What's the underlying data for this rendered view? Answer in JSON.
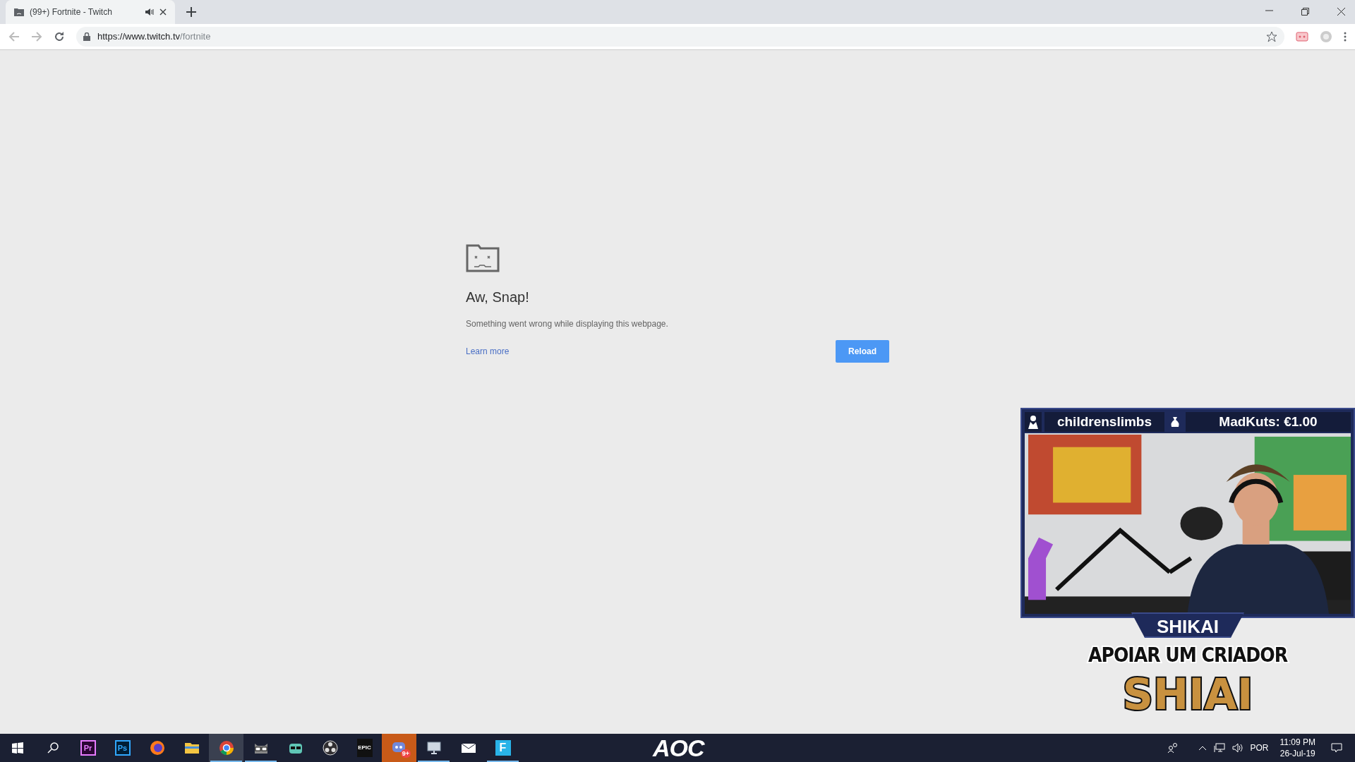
{
  "browser": {
    "tab": {
      "title": "(99+) Fortnite - Twitch",
      "audio": true,
      "selected": true
    },
    "url": {
      "host": "https://www.twitch.tv",
      "path": "/fortnite"
    }
  },
  "error_page": {
    "title": "Aw, Snap!",
    "message": "Something went wrong while displaying this webpage.",
    "link": "Learn more",
    "button": "Reload"
  },
  "overlay": {
    "viewer": "childrenslimbs",
    "donation": "MadKuts: €1.00",
    "banner": "SHIKAI",
    "caption": "APOIAR UM CRIADOR",
    "code": "SHIAI"
  },
  "monitor_logo": "AOC",
  "taskbar": {
    "apps": [
      {
        "kind": "premiere",
        "label": "Pr",
        "running": false,
        "selected": false
      },
      {
        "kind": "photoshop",
        "label": "Ps",
        "running": false,
        "selected": false
      },
      {
        "kind": "firefox",
        "running": false,
        "selected": false
      },
      {
        "kind": "folder",
        "running": false,
        "selected": false
      },
      {
        "kind": "chrome",
        "running": true,
        "selected": true
      },
      {
        "kind": "cat",
        "running": true,
        "selected": false
      },
      {
        "kind": "glasses",
        "running": false,
        "selected": false
      },
      {
        "kind": "obs",
        "running": false,
        "selected": false
      },
      {
        "kind": "epic",
        "label": "EPIC",
        "running": false,
        "selected": false
      },
      {
        "kind": "discord",
        "badge": "9+",
        "running": false,
        "selected": false,
        "attention": true
      },
      {
        "kind": "monitor",
        "running": true,
        "selected": false
      },
      {
        "kind": "mail",
        "running": false,
        "selected": false
      },
      {
        "kind": "fortnite",
        "label": "F",
        "running": true,
        "selected": false
      }
    ],
    "tray": {
      "language": "POR",
      "time": "11:09 PM",
      "date": "26-Jul-19"
    }
  }
}
